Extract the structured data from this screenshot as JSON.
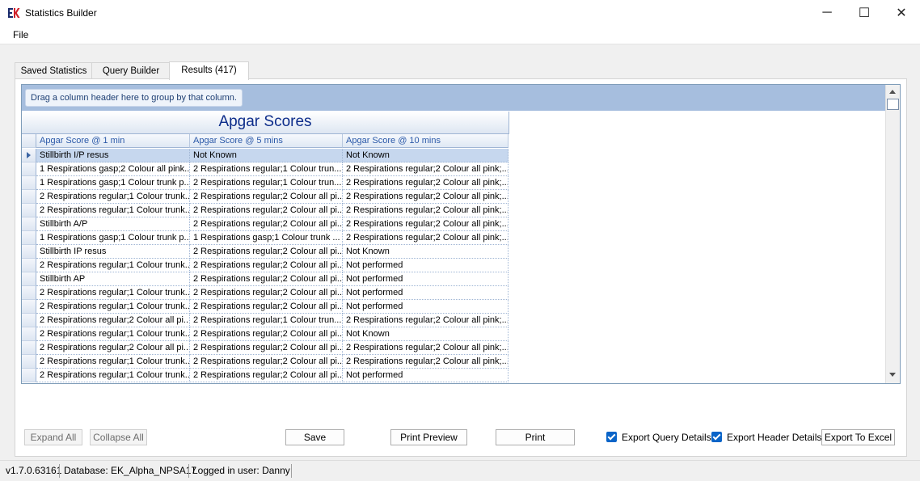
{
  "window": {
    "title": "Statistics Builder",
    "icon": "ek-app-logo-icon",
    "controls": {
      "minimize": "─",
      "maximize": "☐",
      "close": "✕"
    }
  },
  "menu": {
    "file": "File"
  },
  "tabs": [
    {
      "label": "Saved Statistics",
      "active": false
    },
    {
      "label": "Query Builder",
      "active": false
    },
    {
      "label": "Results (417)",
      "active": true
    }
  ],
  "grid": {
    "group_hint": "Drag a column header here to group by that column.",
    "band_title": "Apgar Scores",
    "columns": [
      "Apgar Score @ 1 min",
      "Apgar Score @ 5 mins",
      "Apgar Score @ 10 mins"
    ],
    "selected_row": 0,
    "rows": [
      [
        "Stillbirth I/P resus",
        "Not Known",
        "Not Known"
      ],
      [
        "1 Respirations gasp;2 Colour all pink...",
        "2 Respirations regular;1 Colour trun...",
        "2 Respirations regular;2 Colour all pink;..."
      ],
      [
        "1 Respirations gasp;1 Colour trunk p...",
        "2 Respirations regular;1 Colour trun...",
        "2 Respirations regular;2 Colour all pink;..."
      ],
      [
        "2 Respirations regular;1 Colour trunk...",
        "2 Respirations regular;2 Colour all pi...",
        "2 Respirations regular;2 Colour all pink;..."
      ],
      [
        "2 Respirations regular;1 Colour trunk...",
        "2 Respirations regular;2 Colour all pi...",
        "2 Respirations regular;2 Colour all pink;..."
      ],
      [
        "Stillbirth A/P",
        "2 Respirations regular;2 Colour all pi...",
        "2 Respirations regular;2 Colour all pink;..."
      ],
      [
        "1 Respirations gasp;1 Colour trunk p...",
        "1 Respirations gasp;1 Colour trunk ...",
        "2 Respirations regular;2 Colour all pink;..."
      ],
      [
        "Stillbirth IP resus",
        "2 Respirations regular;2 Colour all pi...",
        "Not Known"
      ],
      [
        "2 Respirations regular;1 Colour trunk...",
        "2 Respirations regular;2 Colour all pi...",
        "Not performed"
      ],
      [
        "Stillbirth AP",
        "2 Respirations regular;2 Colour all pi...",
        "Not performed"
      ],
      [
        "2 Respirations regular;1 Colour trunk...",
        "2 Respirations regular;2 Colour all pi...",
        "Not performed"
      ],
      [
        "2 Respirations regular;1 Colour trunk...",
        "2 Respirations regular;2 Colour all pi...",
        "Not performed"
      ],
      [
        "2 Respirations regular;2 Colour all pi...",
        "2 Respirations regular;1 Colour trun...",
        "2 Respirations regular;2 Colour all pink;..."
      ],
      [
        "2 Respirations regular;1 Colour trunk...",
        "2 Respirations regular;2 Colour all pi...",
        "Not Known"
      ],
      [
        "2 Respirations regular;2 Colour all pi...",
        "2 Respirations regular;2 Colour all pi...",
        "2 Respirations regular;2 Colour all pink;..."
      ],
      [
        "2 Respirations regular;1 Colour trunk...",
        "2 Respirations regular;2 Colour all pi...",
        "2 Respirations regular;2 Colour all pink;..."
      ],
      [
        "2 Respirations regular;1 Colour trunk...",
        "2 Respirations regular;2 Colour all pi...",
        "Not performed"
      ]
    ]
  },
  "buttons": {
    "expand_all": "Expand All",
    "collapse_all": "Collapse All",
    "save": "Save",
    "print_preview": "Print Preview",
    "print": "Print",
    "export_to_excel": "Export To Excel"
  },
  "checkboxes": {
    "export_query_details": {
      "label": "Export Query Details",
      "checked": true
    },
    "export_header_details": {
      "label": "Export Header Details",
      "checked": true
    }
  },
  "status": {
    "version": "v1.7.0.63161",
    "database": "Database: EK_Alpha_NPSA17",
    "user": "Logged in user: Danny"
  },
  "colors": {
    "accent": "#0a64c8",
    "grid_header_text": "#2a58a8",
    "band_title": "#0d2d8a",
    "group_panel": "#a6bede"
  }
}
